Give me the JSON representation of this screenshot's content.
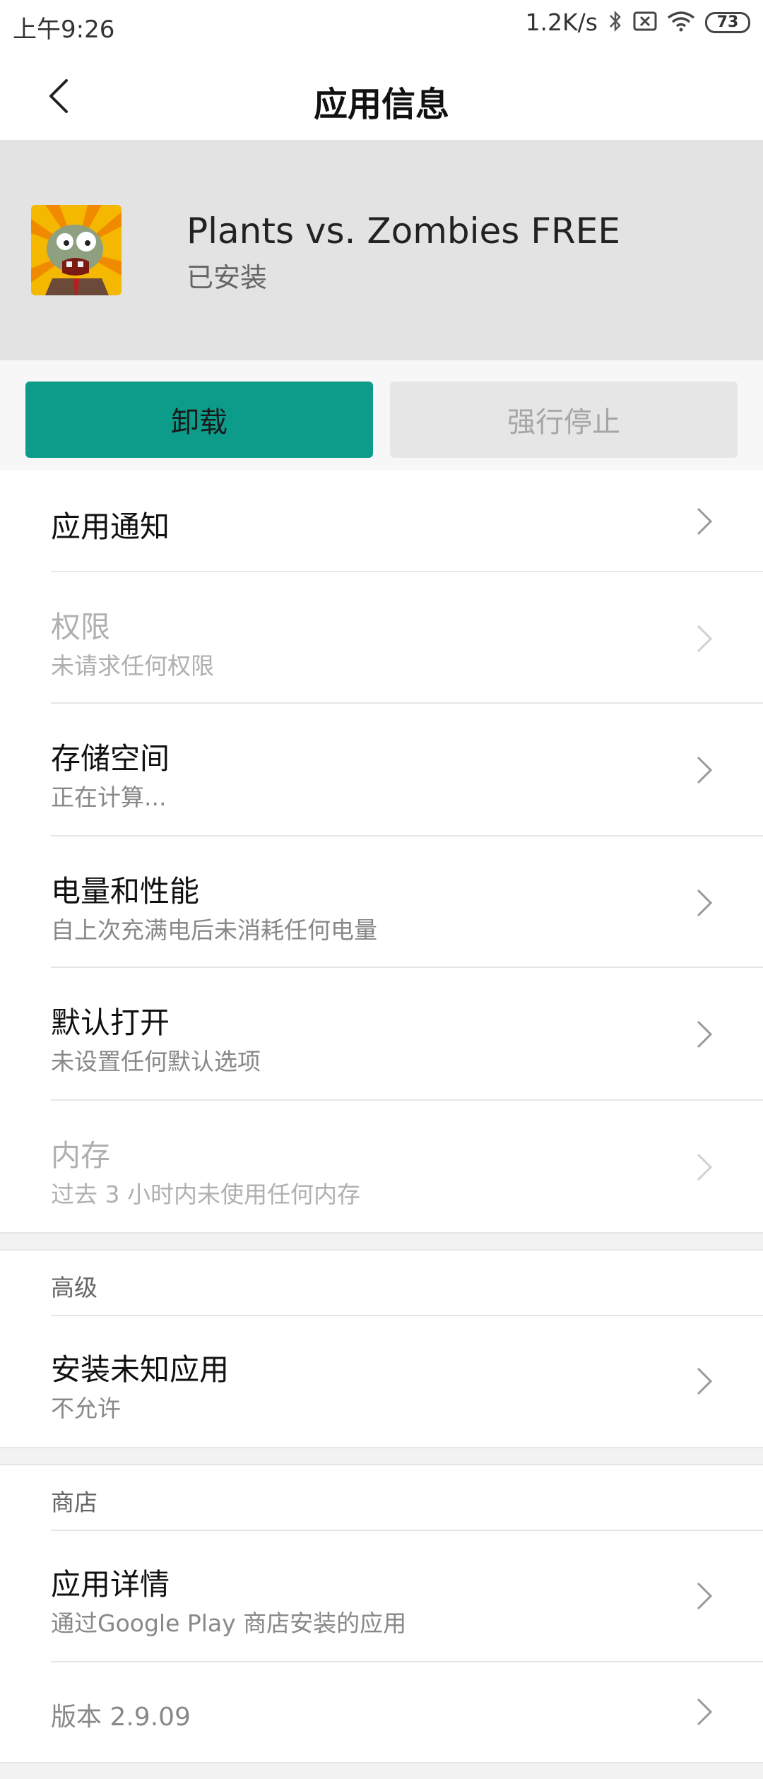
{
  "status_bar": {
    "time": "上午9:26",
    "net_speed": "1.2K/s",
    "battery": "73",
    "icons": [
      "bluetooth-icon",
      "no-sim-icon",
      "wifi-icon",
      "battery-icon"
    ]
  },
  "header": {
    "title": "应用信息",
    "back_icon": "chevron-left-icon"
  },
  "app": {
    "name": "Plants vs. Zombies FREE",
    "status": "已安装",
    "icon": "zombie-app-icon"
  },
  "actions": {
    "uninstall_label": "卸载",
    "force_stop_label": "强行停止",
    "accent_color": "#0d9c8a"
  },
  "items": [
    {
      "title": "应用通知",
      "subtitle": ""
    },
    {
      "title": "权限",
      "subtitle": "未请求任何权限"
    },
    {
      "title": "存储空间",
      "subtitle": "正在计算..."
    },
    {
      "title": "电量和性能",
      "subtitle": "自上次充满电后未消耗任何电量"
    },
    {
      "title": "默认打开",
      "subtitle": "未设置任何默认选项"
    },
    {
      "title": "内存",
      "subtitle": "过去 3 小时内未使用任何内存"
    }
  ],
  "advanced": {
    "header": "高级",
    "items": [
      {
        "title": "安装未知应用",
        "subtitle": "不允许"
      }
    ]
  },
  "store": {
    "header": "商店",
    "items": [
      {
        "title": "应用详情",
        "subtitle": "通过Google Play 商店安装的应用"
      }
    ],
    "version": "版本 2.9.09"
  }
}
